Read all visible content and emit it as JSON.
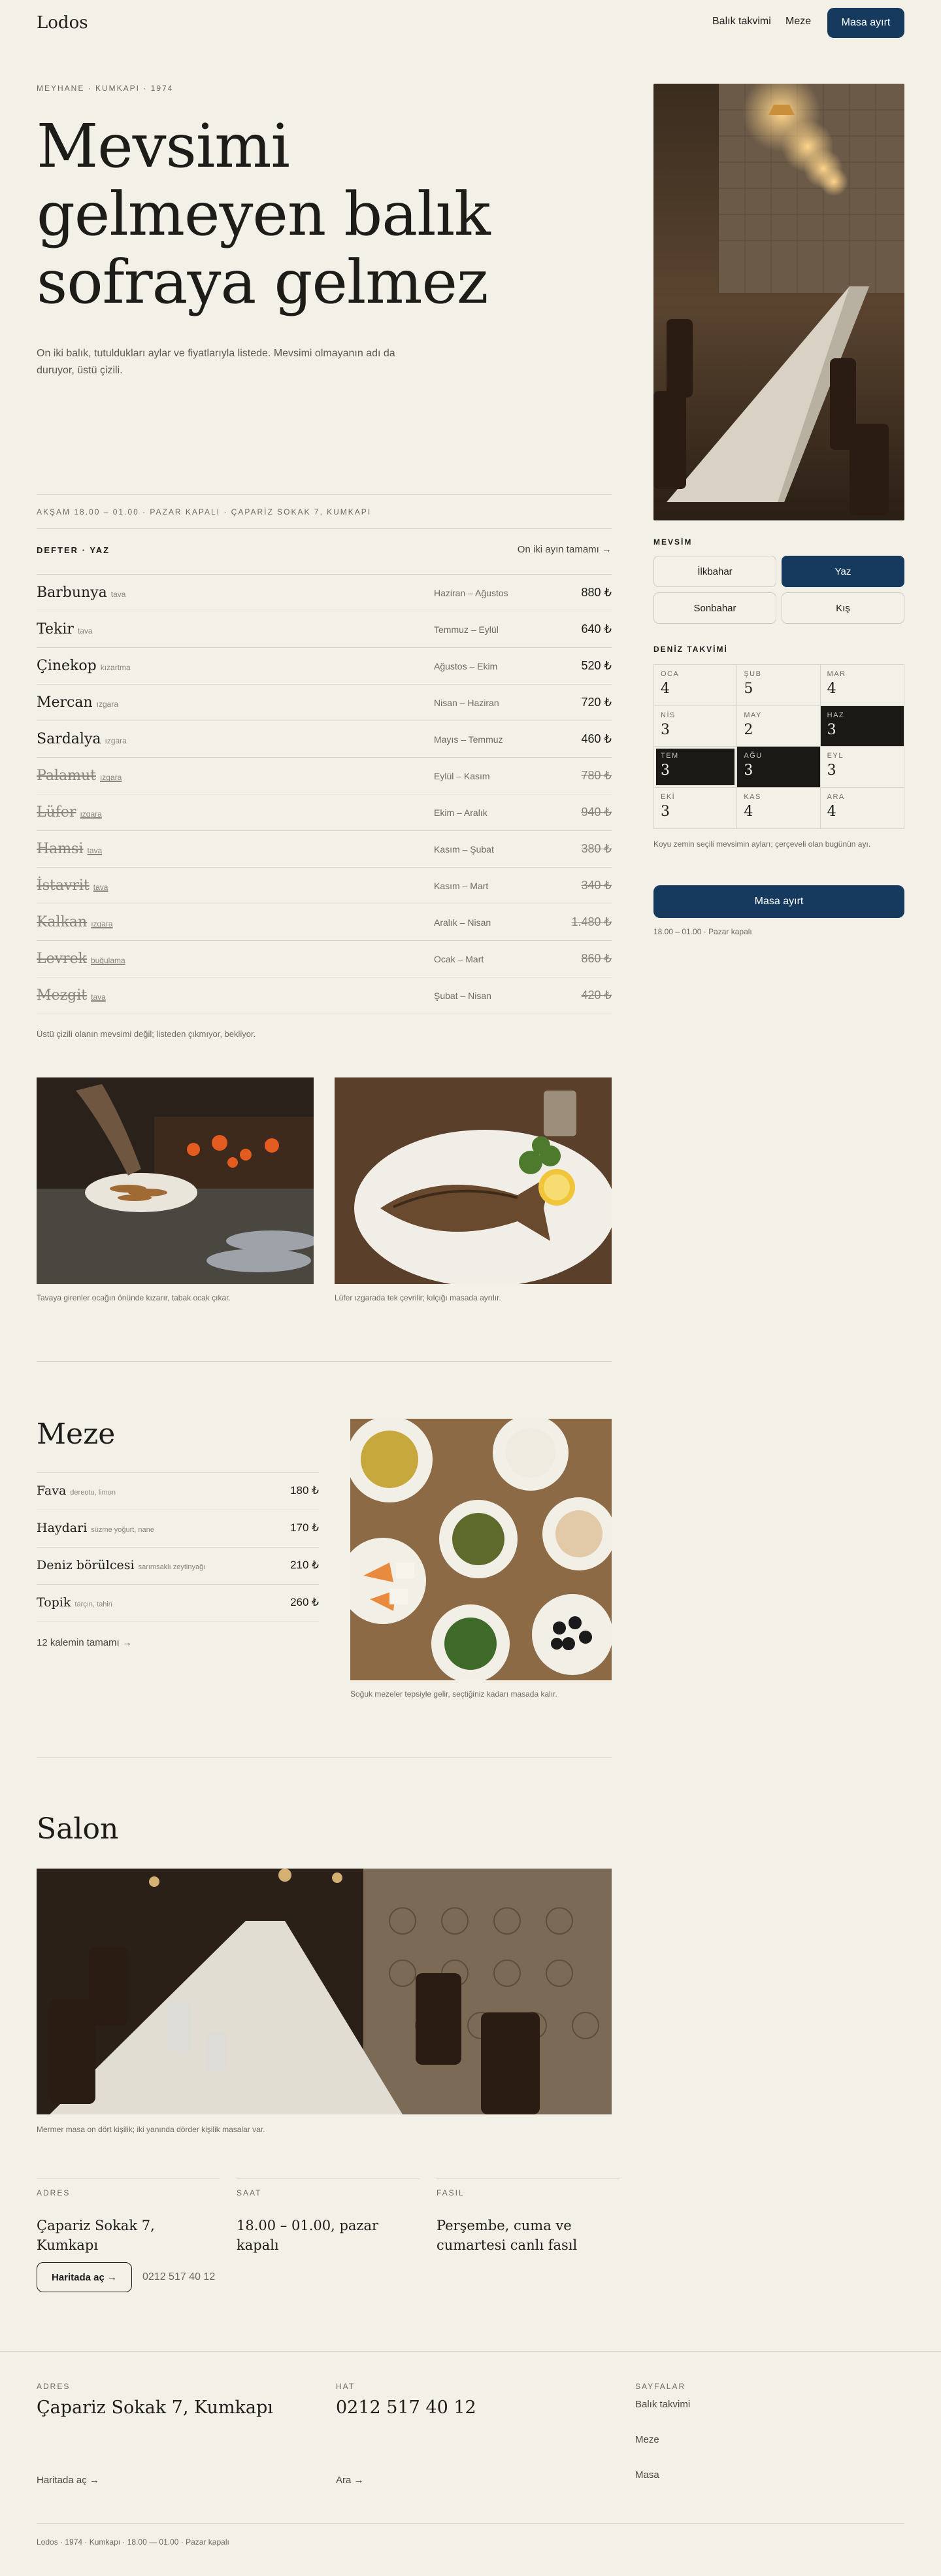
{
  "nav": {
    "logo": "Lodos",
    "fish_link": "Balık takvimi",
    "meze_link": "Meze",
    "book": "Masa ayırt"
  },
  "hero": {
    "eyebrow": "MEYHANE · KUMKAPI · 1974",
    "title": "Mevsimi gelmeyen balık sofraya gelmez",
    "desc": "On iki balık, tutuldukları aylar ve fiyatlarıyla listede. Mevsimi olmayanın adı da duruyor, üstü çizili.",
    "meta": "AKŞAM 18.00 – 01.00 · PAZAR KAPALI · ÇAPARİZ SOKAK 7, KUMKAPI"
  },
  "defter": {
    "title": "DEFTER · YAZ",
    "all_link": "On iki ayın tamamı →",
    "items": [
      {
        "name": "Barbunya",
        "note": "tava",
        "season": "Haziran – Ağustos",
        "price": "880 ₺",
        "off": false
      },
      {
        "name": "Tekir",
        "note": "tava",
        "season": "Temmuz – Eylül",
        "price": "640 ₺",
        "off": false
      },
      {
        "name": "Çinekop",
        "note": "kızartma",
        "season": "Ağustos – Ekim",
        "price": "520 ₺",
        "off": false
      },
      {
        "name": "Mercan",
        "note": "ızgara",
        "season": "Nisan – Haziran",
        "price": "720 ₺",
        "off": false
      },
      {
        "name": "Sardalya",
        "note": "ızgara",
        "season": "Mayıs – Temmuz",
        "price": "460 ₺",
        "off": false
      },
      {
        "name": "Palamut",
        "note": "ızgara",
        "season": "Eylül – Kasım",
        "price": "780 ₺",
        "off": true
      },
      {
        "name": "Lüfer",
        "note": "ızgara",
        "season": "Ekim – Aralık",
        "price": "940 ₺",
        "off": true
      },
      {
        "name": "Hamsi",
        "note": "tava",
        "season": "Kasım – Şubat",
        "price": "380 ₺",
        "off": true
      },
      {
        "name": "İstavrit",
        "note": "tava",
        "season": "Kasım – Mart",
        "price": "340 ₺",
        "off": true
      },
      {
        "name": "Kalkan",
        "note": "ızgara",
        "season": "Aralık – Nisan",
        "price": "1.480 ₺",
        "off": true
      },
      {
        "name": "Levrek",
        "note": "buğulama",
        "season": "Ocak – Mart",
        "price": "860 ₺",
        "off": true
      },
      {
        "name": "Mezgit",
        "note": "tava",
        "season": "Şubat – Nisan",
        "price": "420 ₺",
        "off": true
      }
    ],
    "footnote": "Üstü çizili olanın mevsimi değil; listeden çıkmıyor, bekliyor."
  },
  "sidebar": {
    "season_label": "MEVSİM",
    "seasons": [
      "İlkbahar",
      "Yaz",
      "Sonbahar",
      "Kış"
    ],
    "active_season": "Yaz",
    "calendar_label": "DENİZ TAKVİMİ",
    "months": [
      {
        "m": "OCA",
        "v": "4",
        "state": ""
      },
      {
        "m": "ŞUB",
        "v": "5",
        "state": ""
      },
      {
        "m": "MAR",
        "v": "4",
        "state": ""
      },
      {
        "m": "NİS",
        "v": "3",
        "state": ""
      },
      {
        "m": "MAY",
        "v": "2",
        "state": ""
      },
      {
        "m": "HAZ",
        "v": "3",
        "state": "dark"
      },
      {
        "m": "TEM",
        "v": "3",
        "state": "dark ring"
      },
      {
        "m": "AĞU",
        "v": "3",
        "state": "dark"
      },
      {
        "m": "EYL",
        "v": "3",
        "state": ""
      },
      {
        "m": "EKİ",
        "v": "3",
        "state": ""
      },
      {
        "m": "KAS",
        "v": "4",
        "state": ""
      },
      {
        "m": "ARA",
        "v": "4",
        "state": ""
      }
    ],
    "calendar_note": "Koyu zemin seçili mevsimin ayları; çerçeveli olan bugünün ayı.",
    "book": "Masa ayırt",
    "hours": "18.00 – 01.00 · Pazar kapalı"
  },
  "photos": {
    "grill_caption": "Tavaya girenler ocağın önünde kızarır, tabak ocak çıkar.",
    "fish_caption": "Lüfer ızgarada tek çevrilir; kılçığı masada ayrılır."
  },
  "meze": {
    "title": "Meze",
    "items": [
      {
        "name": "Fava",
        "note": "dereotu, limon",
        "price": "180 ₺"
      },
      {
        "name": "Haydari",
        "note": "süzme yoğurt, nane",
        "price": "170 ₺"
      },
      {
        "name": "Deniz börülcesi",
        "note": "sarımsaklı zeytinyağı",
        "price": "210 ₺"
      },
      {
        "name": "Topik",
        "note": "tarçın, tahin",
        "price": "260 ₺"
      }
    ],
    "all_link": "12 kalemin tamamı →",
    "caption": "Soğuk mezeler tepsiyle gelir, seçtiğiniz kadarı masada kalır."
  },
  "salon": {
    "title": "Salon",
    "caption": "Mermer masa on dört kişilik; iki yanında dörder kişilik masalar var.",
    "info": [
      {
        "label": "ADRES",
        "value": "Çapariz Sokak 7, Kumkapı"
      },
      {
        "label": "SAAT",
        "value": "18.00 – 01.00, pazar kapalı"
      },
      {
        "label": "FASIL",
        "value": "Perşembe, cuma ve cumartesi canlı fasıl"
      }
    ],
    "map_button": "Haritada aç →",
    "phone": "0212 517 40 12"
  },
  "footer": {
    "address_label": "ADRES",
    "address": "Çapariz Sokak 7, Kumkapı",
    "phone_label": "HAT",
    "phone": "0212 517 40 12",
    "pages_label": "SAYFALAR",
    "pages": [
      "Balık takvimi",
      "Meze",
      "Masa"
    ],
    "map_link": "Haritada aç →",
    "call_link": "Ara →",
    "copy": "Lodos · 1974 · Kumkapı · 18.00 — 01.00 · Pazar kapalı"
  },
  "colors": {
    "background": "#f3f0e8",
    "accent": "#163a5e",
    "ink": "#1d1c19",
    "dark_cell": "#1a1916"
  }
}
